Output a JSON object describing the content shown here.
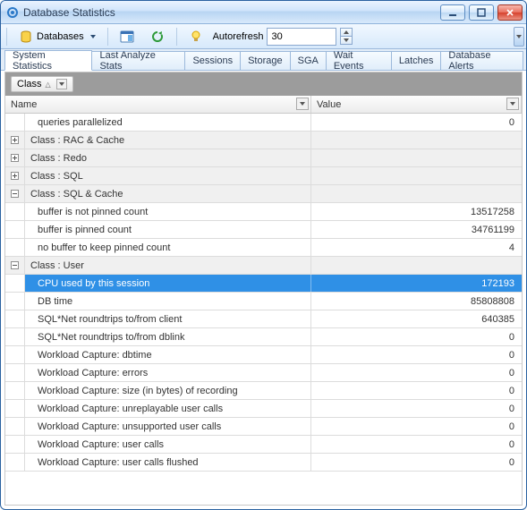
{
  "window": {
    "title": "Database Statistics"
  },
  "toolbar": {
    "databases_label": "Databases",
    "autorefresh_label": "Autorefresh",
    "autorefresh_value": "30"
  },
  "tabs": [
    {
      "label": "System Statistics",
      "active": true
    },
    {
      "label": "Last Analyze Stats",
      "active": false
    },
    {
      "label": "Sessions",
      "active": false
    },
    {
      "label": "Storage",
      "active": false
    },
    {
      "label": "SGA",
      "active": false
    },
    {
      "label": "Wait Events",
      "active": false
    },
    {
      "label": "Latches",
      "active": false
    },
    {
      "label": "Database Alerts",
      "active": false
    }
  ],
  "group_chip": {
    "label": "Class"
  },
  "columns": {
    "name": "Name",
    "value": "Value"
  },
  "rows": [
    {
      "type": "data",
      "indent": true,
      "name": "queries parallelized",
      "value": "0"
    },
    {
      "type": "class",
      "expand": "+",
      "name": "Class : RAC & Cache"
    },
    {
      "type": "class",
      "expand": "+",
      "name": "Class : Redo"
    },
    {
      "type": "class",
      "expand": "+",
      "name": "Class : SQL"
    },
    {
      "type": "class",
      "expand": "-",
      "name": "Class : SQL & Cache"
    },
    {
      "type": "data",
      "indent": true,
      "name": "buffer is not pinned count",
      "value": "13517258"
    },
    {
      "type": "data",
      "indent": true,
      "name": "buffer is pinned count",
      "value": "34761199"
    },
    {
      "type": "data",
      "indent": true,
      "name": "no buffer to keep pinned count",
      "value": "4"
    },
    {
      "type": "class",
      "expand": "-",
      "name": "Class : User"
    },
    {
      "type": "data",
      "indent": true,
      "selected": true,
      "name": "CPU used by this session",
      "value": "172193"
    },
    {
      "type": "data",
      "indent": true,
      "name": "DB time",
      "value": "85808808"
    },
    {
      "type": "data",
      "indent": true,
      "name": "SQL*Net roundtrips to/from client",
      "value": "640385"
    },
    {
      "type": "data",
      "indent": true,
      "name": "SQL*Net roundtrips to/from dblink",
      "value": "0"
    },
    {
      "type": "data",
      "indent": true,
      "name": "Workload Capture: dbtime",
      "value": "0"
    },
    {
      "type": "data",
      "indent": true,
      "name": "Workload Capture: errors",
      "value": "0"
    },
    {
      "type": "data",
      "indent": true,
      "name": "Workload Capture: size (in bytes) of recording",
      "value": "0"
    },
    {
      "type": "data",
      "indent": true,
      "name": "Workload Capture: unreplayable user calls",
      "value": "0"
    },
    {
      "type": "data",
      "indent": true,
      "name": "Workload Capture: unsupported user calls",
      "value": "0"
    },
    {
      "type": "data",
      "indent": true,
      "name": "Workload Capture: user calls",
      "value": "0"
    },
    {
      "type": "data",
      "indent": true,
      "name": "Workload Capture: user calls flushed",
      "value": "0"
    }
  ]
}
